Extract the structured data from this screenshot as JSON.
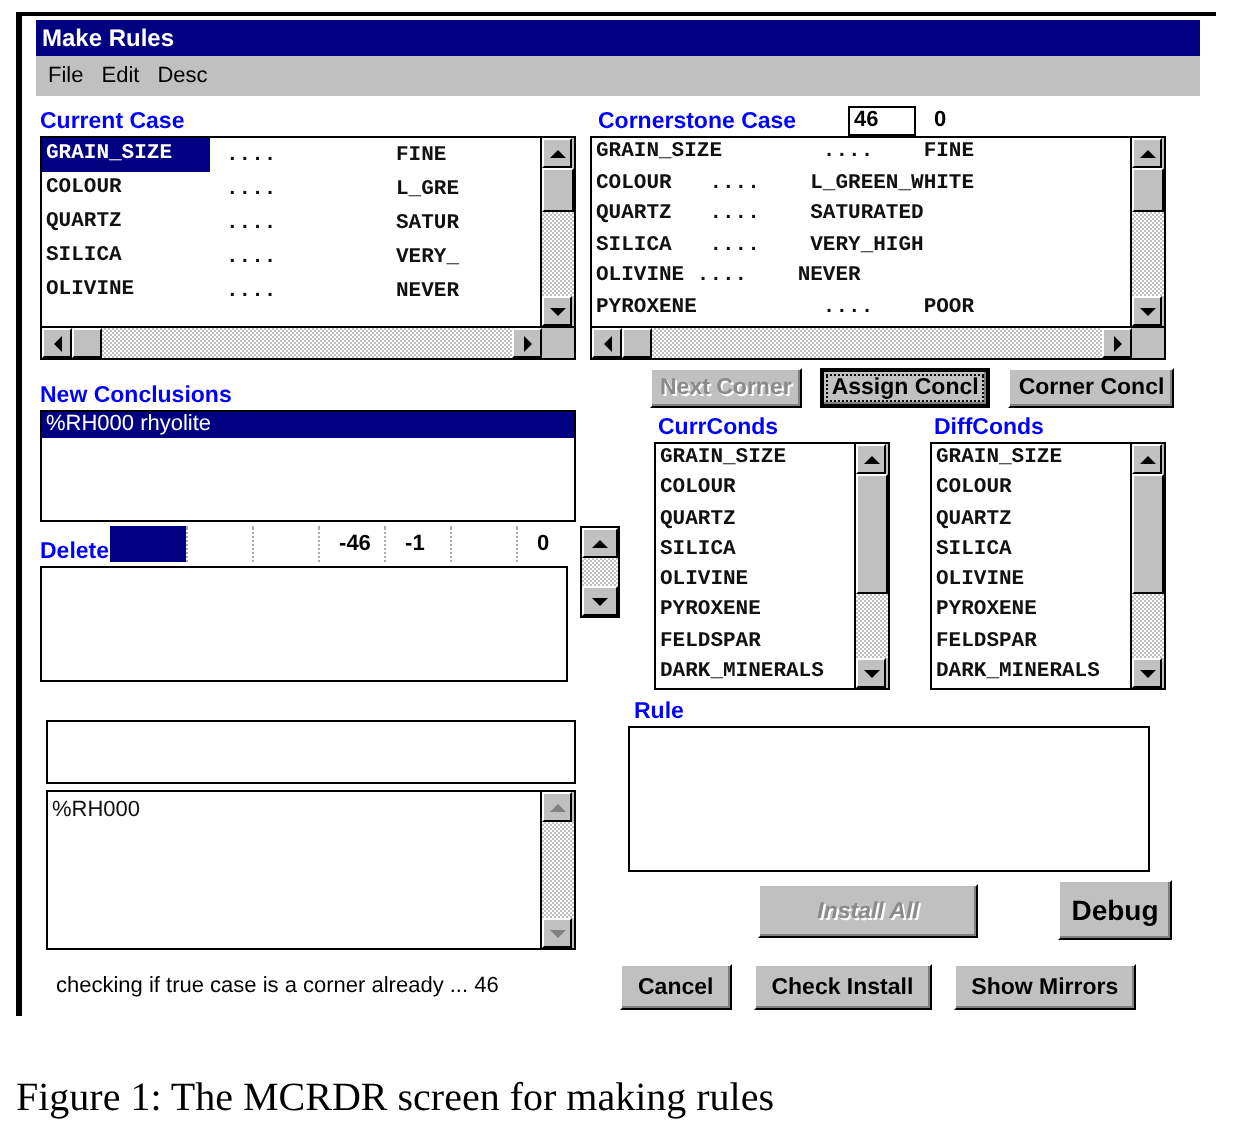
{
  "window": {
    "title": "Make Rules"
  },
  "menu": [
    {
      "label": "File"
    },
    {
      "label": "Edit"
    },
    {
      "label": "Desc"
    }
  ],
  "current_case": {
    "label": "Current Case",
    "rows": [
      {
        "attribute": "GRAIN_SIZE",
        "dots": "....",
        "value": "FINE",
        "selected": true
      },
      {
        "attribute": "COLOUR",
        "dots": "....",
        "value": "L_GRE",
        "selected": false
      },
      {
        "attribute": "QUARTZ",
        "dots": "....",
        "value": "SATUR",
        "selected": false
      },
      {
        "attribute": "SILICA",
        "dots": "....",
        "value": "VERY_",
        "selected": false
      },
      {
        "attribute": "OLIVINE",
        "dots": "....",
        "value": "NEVER",
        "selected": false
      }
    ]
  },
  "cornerstone_case": {
    "label": "Cornerstone Case",
    "case_number": "46",
    "count": "0",
    "rows": [
      "GRAIN_SIZE        ....    FINE",
      "COLOUR   ....    L_GREEN_WHITE",
      "QUARTZ   ....    SATURATED",
      "SILICA   ....    VERY_HIGH",
      "OLIVINE ....    NEVER",
      "PYROXENE          ....    POOR"
    ]
  },
  "corner_buttons": [
    {
      "label": "Next Corner",
      "disabled": true,
      "focused": false
    },
    {
      "label": "Assign Concl",
      "disabled": false,
      "focused": true
    },
    {
      "label": "Corner Concl",
      "disabled": false,
      "focused": false
    }
  ],
  "new_conclusions": {
    "label": "New Conclusions",
    "items": [
      {
        "text": "%RH000 rhyolite",
        "selected": true
      }
    ]
  },
  "grid_strip": {
    "cells": [
      {
        "kind": "filled"
      },
      {
        "kind": "blank"
      },
      {
        "kind": "blank"
      },
      {
        "kind": "text",
        "text": "-46"
      },
      {
        "kind": "text",
        "text": "-1"
      },
      {
        "kind": "blank"
      },
      {
        "kind": "text",
        "text": "0"
      }
    ]
  },
  "delete": {
    "label": "Delete"
  },
  "curr_conds": {
    "label": "CurrConds",
    "items": [
      "GRAIN_SIZE",
      "COLOUR",
      "QUARTZ",
      "SILICA",
      "OLIVINE",
      "PYROXENE",
      "FELDSPAR",
      "DARK_MINERALS"
    ]
  },
  "diff_conds": {
    "label": "DiffConds",
    "items": [
      "GRAIN_SIZE",
      "COLOUR",
      "QUARTZ",
      "SILICA",
      "OLIVINE",
      "PYROXENE",
      "FELDSPAR",
      "DARK_MINERALS"
    ]
  },
  "rule": {
    "label": "Rule"
  },
  "conclusion_list": {
    "items": [
      "%RH000"
    ]
  },
  "install_buttons": [
    {
      "label": "Install All",
      "disabled": true,
      "focused": false
    },
    {
      "label": "Debug",
      "disabled": false,
      "focused": false
    }
  ],
  "status": "checking if true case is a corner already ... 46",
  "bottom_buttons": [
    {
      "label": "Cancel",
      "disabled": false,
      "focused": false
    },
    {
      "label": "Check Install",
      "disabled": false,
      "focused": false
    },
    {
      "label": "Show Mirrors",
      "disabled": false,
      "focused": false
    }
  ],
  "caption": "Figure 1: The MCRDR screen for making rules"
}
